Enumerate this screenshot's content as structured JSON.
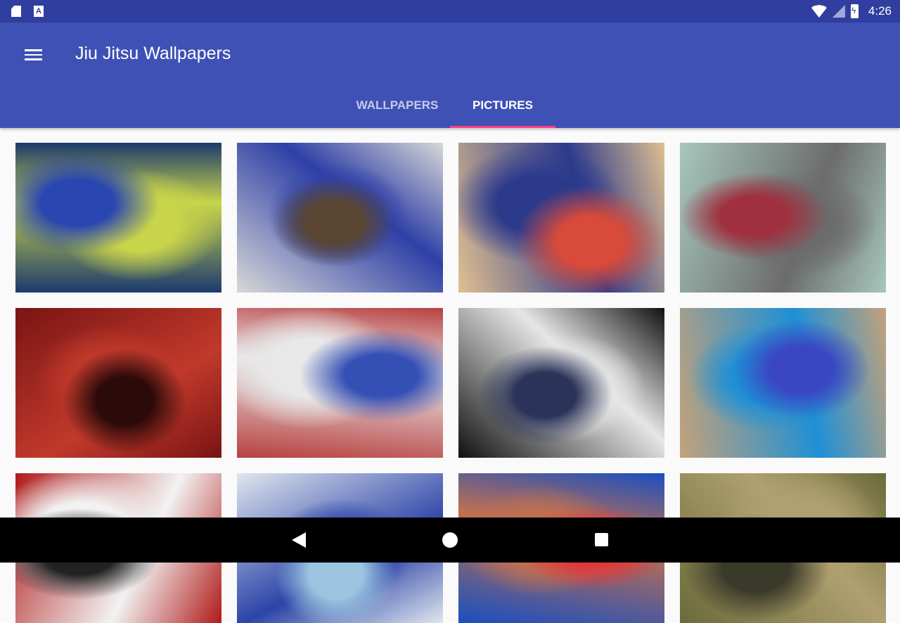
{
  "status_bar": {
    "time": "4:26",
    "left_icons": [
      "sd-card-icon",
      "text-a-icon"
    ],
    "right_icons": [
      "wifi-icon",
      "signal-icon",
      "battery-charging-icon"
    ]
  },
  "app_bar": {
    "title": "Jiu Jitsu Wallpapers",
    "menu_icon": "hamburger-menu-icon",
    "color": "#3f51b5"
  },
  "tabs": [
    {
      "label": "WALLPAPERS",
      "active": false
    },
    {
      "label": "PICTURES",
      "active": true
    }
  ],
  "accent_color": "#ff4081",
  "gallery": {
    "columns": 4,
    "thumbnails": [
      {
        "name": "thumbnail-1",
        "colors": [
          "#1c3a6e",
          "#c8d44a",
          "#2a46b0"
        ]
      },
      {
        "name": "thumbnail-2",
        "colors": [
          "#d8d8d8",
          "#2f40a6",
          "#5a4632"
        ]
      },
      {
        "name": "thumbnail-3",
        "colors": [
          "#e0c090",
          "#2c3a8c",
          "#d84a3a"
        ]
      },
      {
        "name": "thumbnail-4",
        "colors": [
          "#a7c7bd",
          "#6c6c6c",
          "#a03040"
        ]
      },
      {
        "name": "thumbnail-5",
        "colors": [
          "#7a1414",
          "#c0392b",
          "#2b0a0a"
        ]
      },
      {
        "name": "thumbnail-6",
        "colors": [
          "#b84040",
          "#e8e8e8",
          "#3550b5"
        ]
      },
      {
        "name": "thumbnail-7",
        "colors": [
          "#111111",
          "#e6e6e6",
          "#2b3358"
        ]
      },
      {
        "name": "thumbnail-8",
        "colors": [
          "#c4a27a",
          "#1e90d6",
          "#3a46c2"
        ]
      },
      {
        "name": "thumbnail-9",
        "colors": [
          "#b01a1a",
          "#f2f2f2",
          "#222222"
        ]
      },
      {
        "name": "thumbnail-10",
        "colors": [
          "#dfe6ee",
          "#2d44a8",
          "#9ac4e0"
        ]
      },
      {
        "name": "thumbnail-11",
        "colors": [
          "#1a4fbf",
          "#c07050",
          "#e03a3a"
        ]
      },
      {
        "name": "thumbnail-12",
        "colors": [
          "#6a6a3a",
          "#b0a070",
          "#3a3a2a"
        ]
      }
    ]
  },
  "nav_bar": {
    "buttons": [
      "back-icon",
      "home-icon",
      "recents-icon"
    ]
  }
}
